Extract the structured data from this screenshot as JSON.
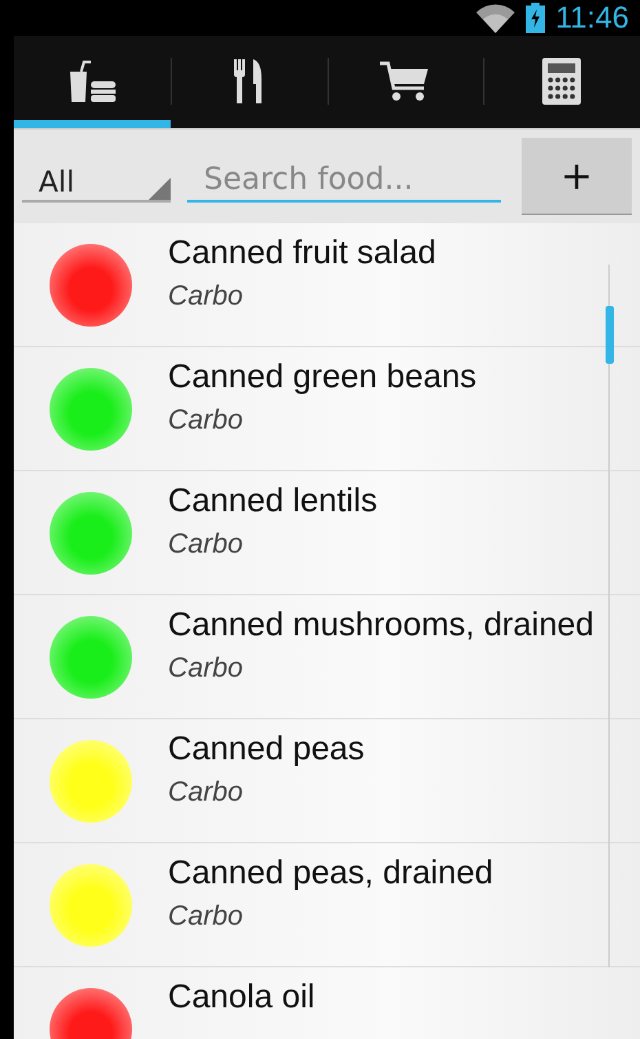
{
  "status_bar": {
    "time": "11:46"
  },
  "tabs": [
    {
      "selected": true
    },
    {
      "selected": false
    },
    {
      "selected": false
    },
    {
      "selected": false
    }
  ],
  "filter": {
    "value": "All"
  },
  "search": {
    "placeholder": "Search food..."
  },
  "add_button": "+",
  "foods": [
    {
      "name": "Canned fruit salad",
      "category": "Carbo",
      "color": "#ff1a1a"
    },
    {
      "name": "Canned green beans",
      "category": "Carbo",
      "color": "#1aee1a"
    },
    {
      "name": "Canned lentils",
      "category": "Carbo",
      "color": "#1aee1a"
    },
    {
      "name": "Canned mushrooms, drained",
      "category": "Carbo",
      "color": "#1aee1a"
    },
    {
      "name": "Canned peas",
      "category": "Carbo",
      "color": "#ffff1a"
    },
    {
      "name": "Canned peas, drained",
      "category": "Carbo",
      "color": "#ffff1a"
    },
    {
      "name": "Canola oil",
      "color": "#ff1a1a"
    }
  ]
}
